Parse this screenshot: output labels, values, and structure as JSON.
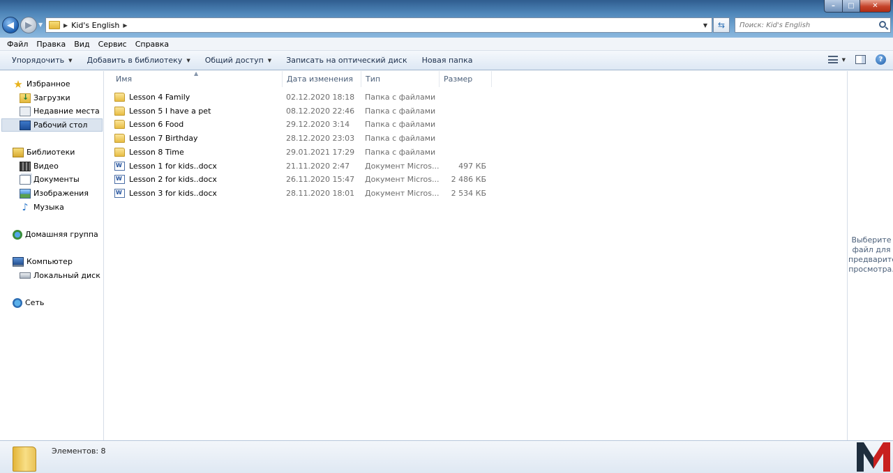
{
  "address": {
    "path": [
      "Kid's English"
    ]
  },
  "search": {
    "placeholder": "Поиск: Kid's English"
  },
  "menubar": [
    "Файл",
    "Правка",
    "Вид",
    "Сервис",
    "Справка"
  ],
  "commandbar": {
    "organize": "Упорядочить",
    "add_to_library": "Добавить в библиотеку",
    "share": "Общий доступ",
    "burn": "Записать на оптический диск",
    "new_folder": "Новая папка"
  },
  "navpane": {
    "favorites": "Избранное",
    "downloads": "Загрузки",
    "recent": "Недавние места",
    "desktop": "Рабочий стол",
    "libraries": "Библиотеки",
    "video": "Видео",
    "documents": "Документы",
    "pictures": "Изображения",
    "music": "Музыка",
    "homegroup": "Домашняя группа",
    "computer": "Компьютер",
    "local_disk": "Локальный диск (C",
    "network": "Сеть"
  },
  "columns": {
    "name": "Имя",
    "date": "Дата изменения",
    "type": "Тип",
    "size": "Размер"
  },
  "files": [
    {
      "name": "Lesson 4 Family",
      "date": "02.12.2020 18:18",
      "type": "Папка с файлами",
      "size": "",
      "kind": "folder"
    },
    {
      "name": "Lesson 5 I have a pet",
      "date": "08.12.2020 22:46",
      "type": "Папка с файлами",
      "size": "",
      "kind": "folder"
    },
    {
      "name": "Lesson 6 Food",
      "date": "29.12.2020 3:14",
      "type": "Папка с файлами",
      "size": "",
      "kind": "folder"
    },
    {
      "name": "Lesson 7 Birthday",
      "date": "28.12.2020 23:03",
      "type": "Папка с файлами",
      "size": "",
      "kind": "folder"
    },
    {
      "name": "Lesson 8 Time",
      "date": "29.01.2021 17:29",
      "type": "Папка с файлами",
      "size": "",
      "kind": "folder"
    },
    {
      "name": "Lesson 1 for kids..docx",
      "date": "21.11.2020 2:47",
      "type": "Документ Micros...",
      "size": "497 КБ",
      "kind": "docx"
    },
    {
      "name": "Lesson 2 for kids..docx",
      "date": "26.11.2020 15:47",
      "type": "Документ Micros...",
      "size": "2 486 КБ",
      "kind": "docx"
    },
    {
      "name": "Lesson 3 for kids..docx",
      "date": "28.11.2020 18:01",
      "type": "Документ Micros...",
      "size": "2 534 КБ",
      "kind": "docx"
    }
  ],
  "preview": {
    "message": "Выберите\nфайл для\nпредварительн\nпросмотра."
  },
  "status": {
    "items": "Элементов: 8"
  },
  "colors": {
    "logo_red": "#c8201f",
    "logo_dark": "#1e2d3d"
  }
}
